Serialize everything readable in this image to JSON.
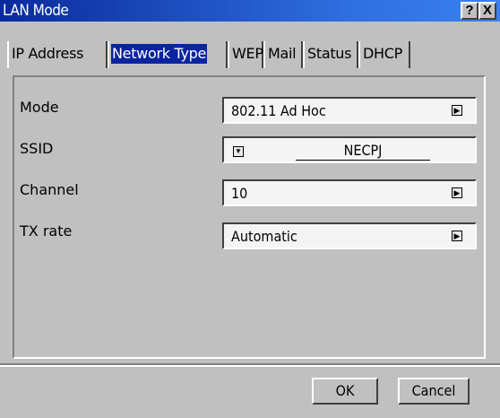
{
  "window": {
    "title": "LAN Mode",
    "help_label": "?",
    "close_label": "X"
  },
  "tabs": [
    {
      "label": "IP Address",
      "active": false
    },
    {
      "label": "Network Type",
      "active": true
    },
    {
      "label": "WEP",
      "active": false
    },
    {
      "label": "Mail",
      "active": false
    },
    {
      "label": "Status",
      "active": false
    },
    {
      "label": "DHCP",
      "active": false
    }
  ],
  "fields": {
    "mode": {
      "label": "Mode",
      "value": "802.11 Ad Hoc"
    },
    "ssid": {
      "label": "SSID",
      "value": "NECPJ"
    },
    "channel": {
      "label": "Channel",
      "value": "10"
    },
    "tx_rate": {
      "label": "TX rate",
      "value": "Automatic"
    }
  },
  "buttons": {
    "ok": "OK",
    "cancel": "Cancel"
  },
  "icons": {
    "dropdown_right": "triangle-right-icon",
    "dropdown_down": "triangle-down-icon"
  },
  "colors": {
    "titlebar_start": "#0a2a9c",
    "titlebar_end": "#3a80f0",
    "selection": "#0a24a0",
    "face": "#c0c0c0"
  }
}
